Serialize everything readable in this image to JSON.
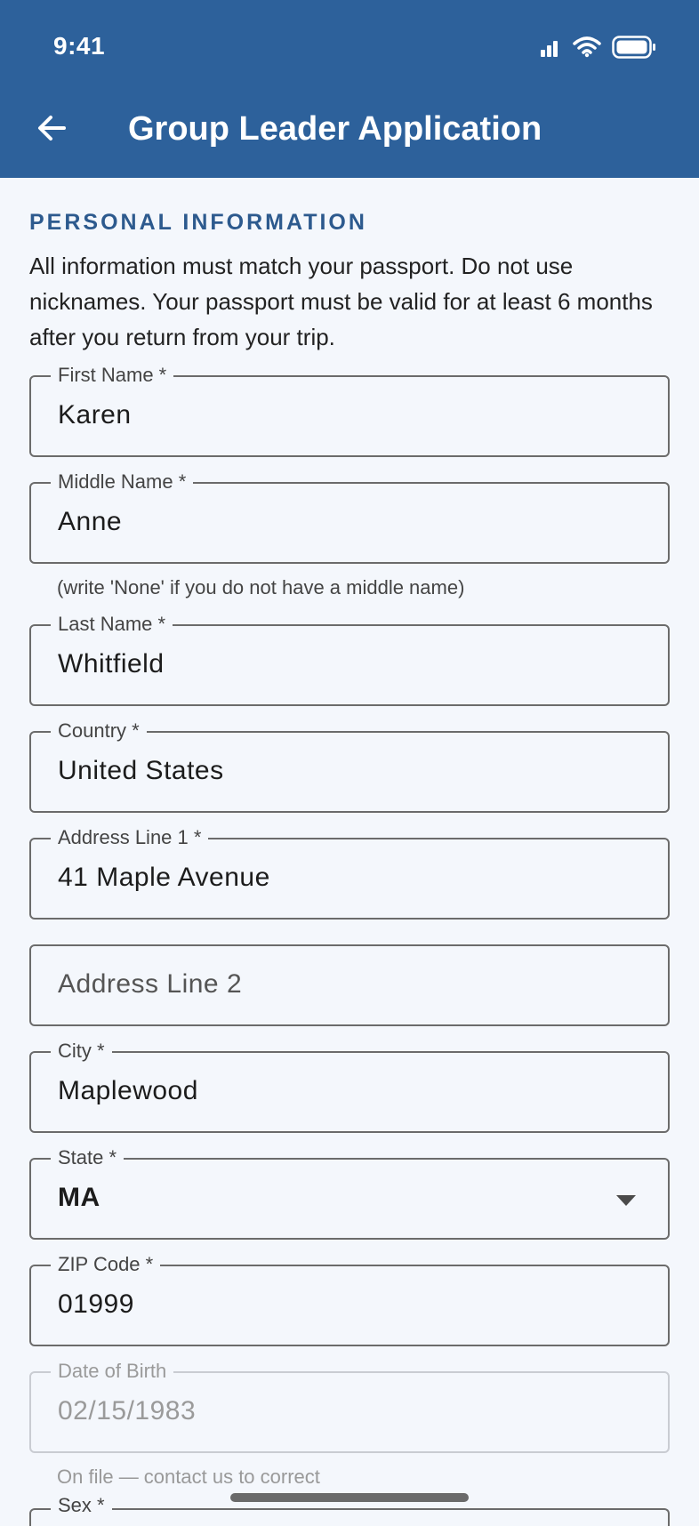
{
  "status_bar": {
    "time": "9:41"
  },
  "app_bar": {
    "title": "Group Leader Application"
  },
  "section": {
    "heading": "PERSONAL INFORMATION",
    "intro": "All information must match your passport. Do not use nicknames. Your passport must be valid for at least 6 months after you return from your trip."
  },
  "fields": {
    "first_name": {
      "label": "First Name *",
      "value": "Karen"
    },
    "middle_name": {
      "label": "Middle Name *",
      "value": "Anne",
      "helper": "(write 'None' if you do not have a middle name)"
    },
    "last_name": {
      "label": "Last Name *",
      "value": "Whitfield"
    },
    "country": {
      "label": "Country *",
      "value": "United States"
    },
    "address1": {
      "label": "Address Line 1 *",
      "value": "41 Maple Avenue"
    },
    "address2": {
      "placeholder": "Address Line 2"
    },
    "city": {
      "label": "City *",
      "value": "Maplewood"
    },
    "state": {
      "label": "State *",
      "value": "MA"
    },
    "zip": {
      "label": "ZIP Code *",
      "value": "01999"
    },
    "dob": {
      "label": "Date of Birth",
      "value": "02/15/1983",
      "helper": "On file — contact us to correct"
    },
    "sex": {
      "label": "Sex *"
    }
  },
  "icons": [
    "back-arrow-icon",
    "signal-icon",
    "wifi-icon",
    "battery-icon",
    "dropdown-arrow-icon"
  ],
  "colors": {
    "app_bar": "#2d619b",
    "section_heading": "#2d5a8e",
    "background": "#f4f7fc"
  }
}
